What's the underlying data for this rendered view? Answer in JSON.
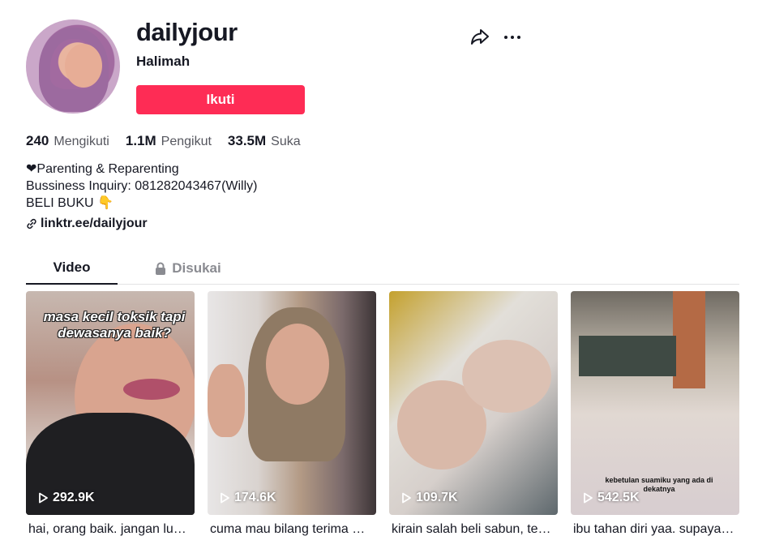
{
  "profile": {
    "username": "dailyjour",
    "nickname": "Halimah",
    "follow_label": "Ikuti"
  },
  "stats": [
    {
      "value": "240",
      "label": "Mengikuti"
    },
    {
      "value": "1.1M",
      "label": "Pengikut"
    },
    {
      "value": "33.5M",
      "label": "Suka"
    }
  ],
  "bio": [
    "❤Parenting & Reparenting",
    "Bussiness Inquiry: 081282043467(Willy)",
    "BELI BUKU 👇"
  ],
  "link": "linktr.ee/dailyjour",
  "tabs": [
    {
      "label": "Video",
      "active": true
    },
    {
      "label": "Disukai",
      "locked": true
    }
  ],
  "videos": [
    {
      "views": "292.9K",
      "caption": "hai, orang baik. jangan lu…",
      "overlay": "masa kecil toksik tapi dewasanya baik?"
    },
    {
      "views": "174.6K",
      "caption": "cuma mau bilang terima …"
    },
    {
      "views": "109.7K",
      "caption": "kirain salah beli sabun, te…"
    },
    {
      "views": "542.5K",
      "caption": "ibu tahan diri yaa. supaya…",
      "overlay": "kebetulan suamiku yang ada di dekatnya"
    }
  ],
  "icons": [
    "share-icon",
    "more-icon",
    "link-icon",
    "lock-icon",
    "play-icon"
  ],
  "colors": {
    "accent": "#fe2c55",
    "text": "#161823",
    "muted": "#8a8b91"
  }
}
